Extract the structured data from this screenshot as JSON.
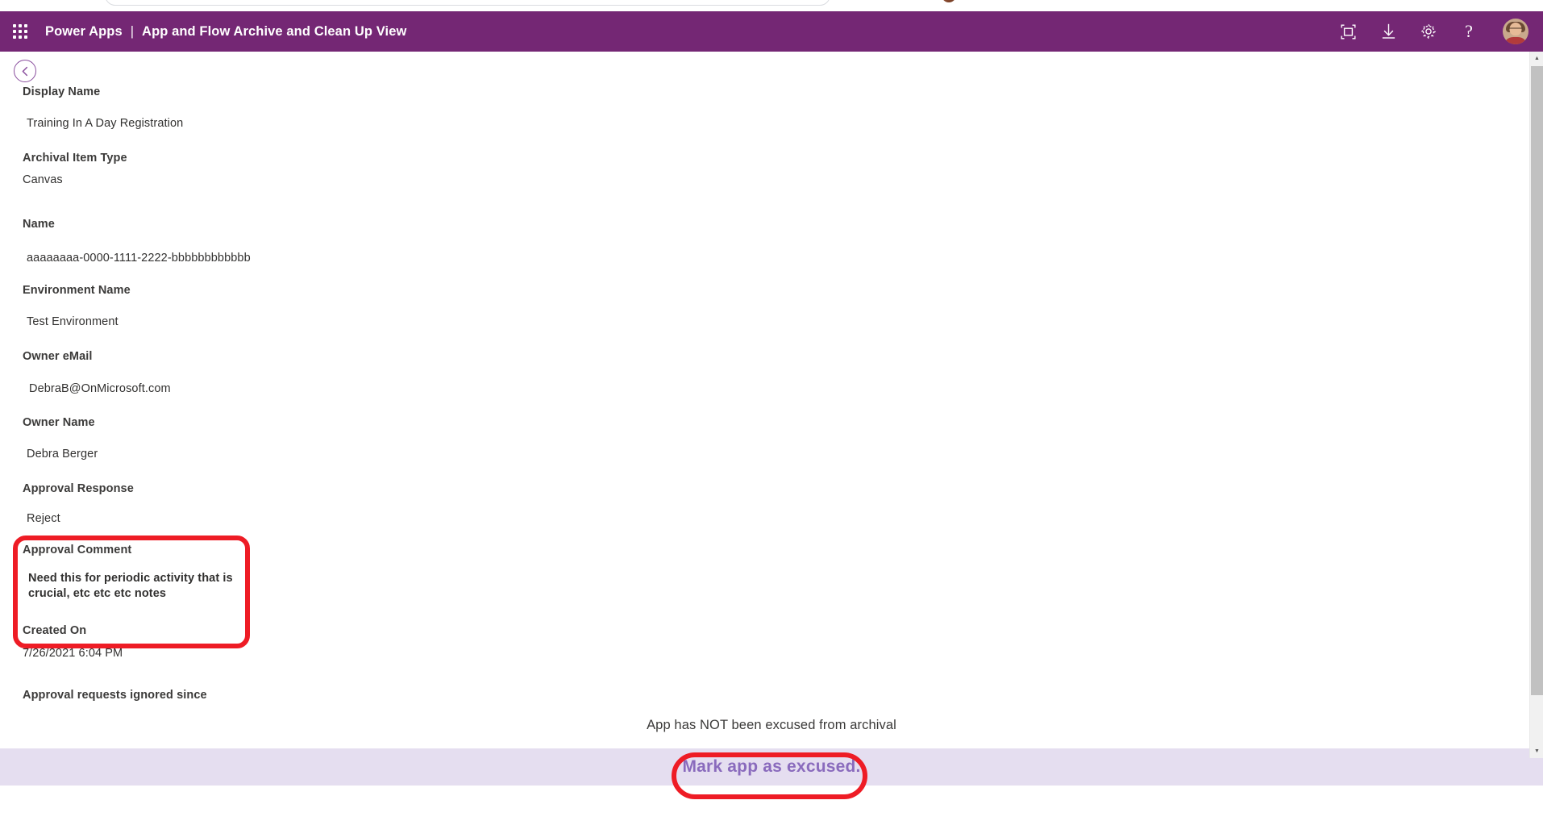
{
  "browser": {
    "nav_back": "‹",
    "nav_forward": "›",
    "reload": "↻",
    "home": "⌂",
    "omnibox_value": "",
    "omnibox_placeholder": "",
    "extensions": [
      "■",
      "◆",
      "▶",
      "⬚"
    ]
  },
  "header": {
    "waffle_icon": "waffle-grid-icon",
    "brand": "Power Apps",
    "separator": "|",
    "page_title": "App and Flow Archive and Clean Up View",
    "actions": [
      {
        "name": "fullscreen-icon",
        "label": "Full screen"
      },
      {
        "name": "download-icon",
        "label": "Download"
      },
      {
        "name": "settings-gear-icon",
        "label": "Settings"
      },
      {
        "name": "help-icon",
        "label": "?"
      }
    ],
    "avatar_label": "User account",
    "brand_color": "#742774"
  },
  "back_button": {
    "name": "back-button",
    "glyph": "‹"
  },
  "form": {
    "fields": [
      {
        "label": "Display Name",
        "value": "Training In A Day Registration"
      },
      {
        "label": "Archival Item Type",
        "value": "Canvas"
      },
      {
        "label": "Name",
        "value": "aaaaaaaa-0000-1111-2222-bbbbbbbbbbbb"
      },
      {
        "label": "Environment Name",
        "value": "Test Environment"
      },
      {
        "label": "Owner eMail",
        "value": "DebraB@OnMicrosoft.com"
      },
      {
        "label": "Owner Name",
        "value": "Debra Berger"
      },
      {
        "label": "Approval Response",
        "value": "Reject"
      },
      {
        "label": "Approval Comment",
        "value": "Need this for periodic activity that is\ncrucial, etc etc etc notes"
      },
      {
        "label": "Created On",
        "value": "7/26/2021 6:04 PM"
      },
      {
        "label": "Approval requests ignored since",
        "value": ""
      }
    ]
  },
  "footer": {
    "status_text": "App has NOT been excused from archival",
    "action_label": "Mark app as excused.",
    "band_color": "#e5def0",
    "action_color": "#8a6bbd"
  },
  "annotations": {
    "highlight_color": "#ee1c25",
    "shapes": [
      {
        "name": "approval-comment-highlight",
        "type": "rect"
      },
      {
        "name": "mark-app-as-excused-highlight",
        "type": "oval"
      }
    ]
  },
  "scrollbar": {
    "up_glyph": "▲",
    "down_glyph": "▼"
  }
}
